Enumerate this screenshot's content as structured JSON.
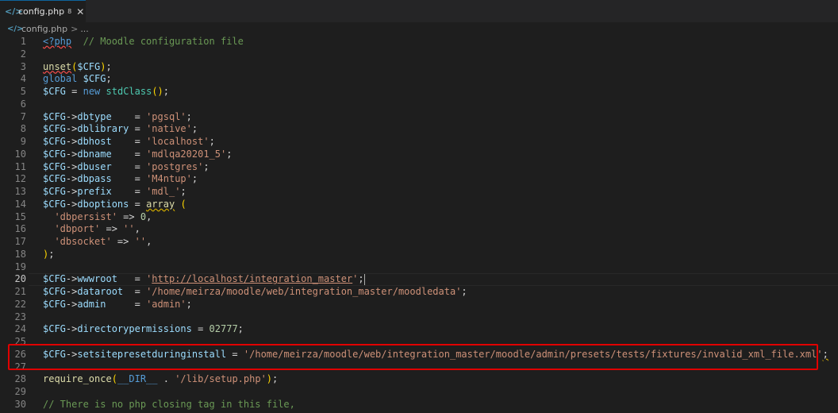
{
  "tab": {
    "icon": "php-file-icon",
    "label": "config.php",
    "modified": "8",
    "close": "✕"
  },
  "breadcrumb": {
    "file": "config.php",
    "sep": ">",
    "rest": "..."
  },
  "lines": [
    {
      "n": "1",
      "t": [
        [
          "c-pre",
          "<?php"
        ],
        [
          "c-op",
          "  "
        ],
        [
          "c-cm",
          "// Moodle configuration file"
        ]
      ]
    },
    {
      "n": "2",
      "t": []
    },
    {
      "n": "3",
      "t": [
        [
          "c-fn-red",
          "unset"
        ],
        [
          "c-paren",
          "("
        ],
        [
          "c-var",
          "$CFG"
        ],
        [
          "c-paren",
          ")"
        ],
        [
          "c-op",
          ";"
        ]
      ]
    },
    {
      "n": "4",
      "t": [
        [
          "c-kw",
          "global"
        ],
        [
          "c-op",
          " "
        ],
        [
          "c-var",
          "$CFG"
        ],
        [
          "c-op",
          ";"
        ]
      ]
    },
    {
      "n": "5",
      "t": [
        [
          "c-var",
          "$CFG"
        ],
        [
          "c-op",
          " = "
        ],
        [
          "c-kw",
          "new"
        ],
        [
          "c-op",
          " "
        ],
        [
          "c-cls",
          "stdClass"
        ],
        [
          "c-paren",
          "()"
        ],
        [
          "c-op",
          ";"
        ]
      ]
    },
    {
      "n": "6",
      "t": []
    },
    {
      "n": "7",
      "t": [
        [
          "c-var",
          "$CFG"
        ],
        [
          "c-op",
          "->"
        ],
        [
          "c-var",
          "dbtype"
        ],
        [
          "c-op",
          "    = "
        ],
        [
          "c-str",
          "'pgsql'"
        ],
        [
          "c-op",
          ";"
        ]
      ]
    },
    {
      "n": "8",
      "t": [
        [
          "c-var",
          "$CFG"
        ],
        [
          "c-op",
          "->"
        ],
        [
          "c-var",
          "dblibrary"
        ],
        [
          "c-op",
          " = "
        ],
        [
          "c-str",
          "'native'"
        ],
        [
          "c-op",
          ";"
        ]
      ]
    },
    {
      "n": "9",
      "t": [
        [
          "c-var",
          "$CFG"
        ],
        [
          "c-op",
          "->"
        ],
        [
          "c-var",
          "dbhost"
        ],
        [
          "c-op",
          "    = "
        ],
        [
          "c-str",
          "'localhost'"
        ],
        [
          "c-op",
          ";"
        ]
      ]
    },
    {
      "n": "10",
      "t": [
        [
          "c-var",
          "$CFG"
        ],
        [
          "c-op",
          "->"
        ],
        [
          "c-var",
          "dbname"
        ],
        [
          "c-op",
          "    = "
        ],
        [
          "c-str",
          "'mdlqa20201_5'"
        ],
        [
          "c-op",
          ";"
        ]
      ]
    },
    {
      "n": "11",
      "t": [
        [
          "c-var",
          "$CFG"
        ],
        [
          "c-op",
          "->"
        ],
        [
          "c-var",
          "dbuser"
        ],
        [
          "c-op",
          "    = "
        ],
        [
          "c-str",
          "'postgres'"
        ],
        [
          "c-op",
          ";"
        ]
      ]
    },
    {
      "n": "12",
      "t": [
        [
          "c-var",
          "$CFG"
        ],
        [
          "c-op",
          "->"
        ],
        [
          "c-var",
          "dbpass"
        ],
        [
          "c-op",
          "    = "
        ],
        [
          "c-str",
          "'M4ntup'"
        ],
        [
          "c-op",
          ";"
        ]
      ]
    },
    {
      "n": "13",
      "t": [
        [
          "c-var",
          "$CFG"
        ],
        [
          "c-op",
          "->"
        ],
        [
          "c-var",
          "prefix"
        ],
        [
          "c-op",
          "    = "
        ],
        [
          "c-str",
          "'mdl_'"
        ],
        [
          "c-op",
          ";"
        ]
      ]
    },
    {
      "n": "14",
      "t": [
        [
          "c-var",
          "$CFG"
        ],
        [
          "c-op",
          "->"
        ],
        [
          "c-var",
          "dboptions"
        ],
        [
          "c-op",
          " = "
        ],
        [
          "c-fn-yel",
          "array"
        ],
        [
          "c-op",
          " "
        ],
        [
          "c-paren",
          "("
        ]
      ]
    },
    {
      "n": "15",
      "t": [
        [
          "c-op",
          "  "
        ],
        [
          "c-str",
          "'dbpersist'"
        ],
        [
          "c-op",
          " => "
        ],
        [
          "c-num",
          "0"
        ],
        [
          "c-op",
          ","
        ]
      ]
    },
    {
      "n": "16",
      "t": [
        [
          "c-op",
          "  "
        ],
        [
          "c-str",
          "'dbport'"
        ],
        [
          "c-op",
          " => "
        ],
        [
          "c-str",
          "''"
        ],
        [
          "c-op",
          ","
        ]
      ]
    },
    {
      "n": "17",
      "t": [
        [
          "c-op",
          "  "
        ],
        [
          "c-str",
          "'dbsocket'"
        ],
        [
          "c-op",
          " => "
        ],
        [
          "c-str",
          "''"
        ],
        [
          "c-op",
          ","
        ]
      ]
    },
    {
      "n": "18",
      "t": [
        [
          "c-paren",
          ")"
        ],
        [
          "c-op",
          ";"
        ]
      ]
    },
    {
      "n": "19",
      "t": []
    },
    {
      "n": "20",
      "active": true,
      "t": [
        [
          "c-var",
          "$CFG"
        ],
        [
          "c-op",
          "->"
        ],
        [
          "c-var",
          "wwwroot"
        ],
        [
          "c-op",
          "   = "
        ],
        [
          "c-str",
          "'"
        ],
        [
          "c-str-link",
          "http://localhost/integration_master"
        ],
        [
          "c-str",
          "'"
        ],
        [
          "c-op",
          ";"
        ],
        [
          "c-cursor",
          ""
        ]
      ]
    },
    {
      "n": "21",
      "t": [
        [
          "c-var",
          "$CFG"
        ],
        [
          "c-op",
          "->"
        ],
        [
          "c-var",
          "dataroot"
        ],
        [
          "c-op",
          "  = "
        ],
        [
          "c-str",
          "'/home/meirza/moodle/web/integration_master/moodledata'"
        ],
        [
          "c-op",
          ";"
        ]
      ]
    },
    {
      "n": "22",
      "t": [
        [
          "c-var",
          "$CFG"
        ],
        [
          "c-op",
          "->"
        ],
        [
          "c-var",
          "admin"
        ],
        [
          "c-op",
          "     = "
        ],
        [
          "c-str",
          "'admin'"
        ],
        [
          "c-op",
          ";"
        ]
      ]
    },
    {
      "n": "23",
      "t": []
    },
    {
      "n": "24",
      "t": [
        [
          "c-var",
          "$CFG"
        ],
        [
          "c-op",
          "->"
        ],
        [
          "c-var",
          "directorypermissions"
        ],
        [
          "c-op",
          " = "
        ],
        [
          "c-num",
          "02777"
        ],
        [
          "c-op",
          ";"
        ]
      ]
    },
    {
      "n": "25",
      "t": []
    },
    {
      "n": "26",
      "t": [
        [
          "c-var",
          "$CFG"
        ],
        [
          "c-op",
          "->"
        ],
        [
          "c-var",
          "setsitepresetduringinstall"
        ],
        [
          "c-op",
          " = "
        ],
        [
          "c-str",
          "'/home/meirza/moodle/web/integration_master/moodle/admin/presets/tests/fixtures/invalid_xml_file.xml'"
        ],
        [
          "c-op-yel",
          ";"
        ]
      ]
    },
    {
      "n": "27",
      "t": []
    },
    {
      "n": "28",
      "t": [
        [
          "c-fn",
          "require_once"
        ],
        [
          "c-paren",
          "("
        ],
        [
          "c-kw",
          "__DIR__"
        ],
        [
          "c-op",
          " . "
        ],
        [
          "c-str",
          "'/lib/setup.php'"
        ],
        [
          "c-paren",
          ")"
        ],
        [
          "c-op",
          ";"
        ]
      ]
    },
    {
      "n": "29",
      "t": []
    },
    {
      "n": "30",
      "t": [
        [
          "c-cm",
          "// There is no php closing tag in this file,"
        ]
      ]
    }
  ]
}
